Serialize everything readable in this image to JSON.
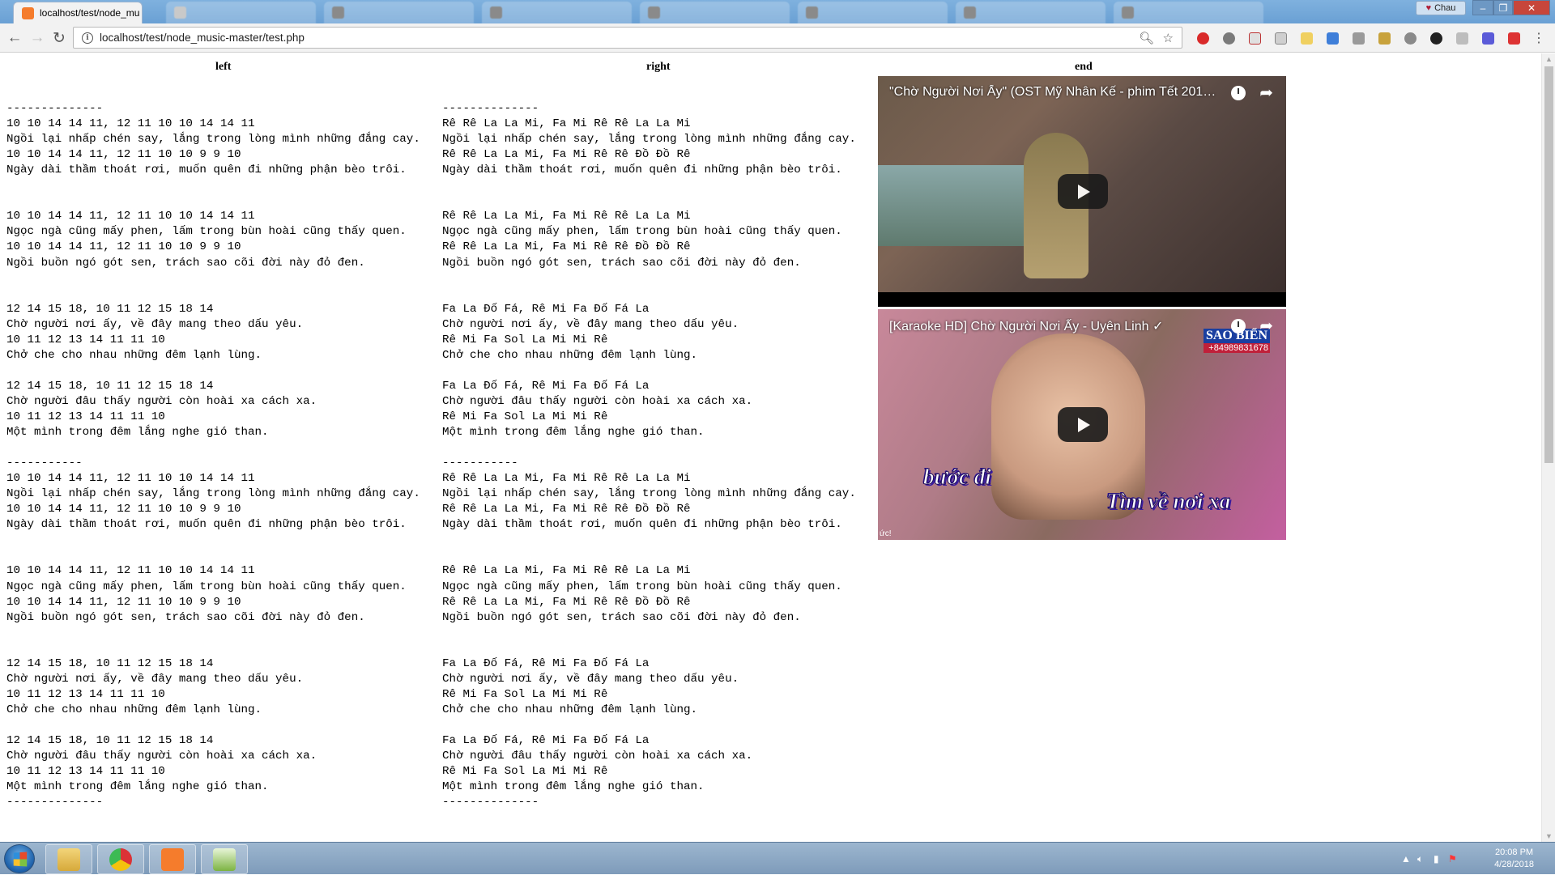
{
  "browser": {
    "tabs": [
      {
        "title": "localhost/test/node_mu",
        "active": true,
        "favicon_color": "#f57c2c"
      },
      {
        "title": "",
        "active": false,
        "favicon_color": "#c9c9c9"
      },
      {
        "title": "",
        "active": false,
        "favicon_color": "#8a8a8a"
      },
      {
        "title": "",
        "active": false,
        "favicon_color": "#8a8a8a"
      },
      {
        "title": "",
        "active": false,
        "favicon_color": "#8a8a8a"
      },
      {
        "title": "",
        "active": false,
        "favicon_color": "#8a8a8a"
      },
      {
        "title": "",
        "active": false,
        "favicon_color": "#8a8a8a"
      },
      {
        "title": "",
        "active": false,
        "favicon_color": "#8a8a8a"
      }
    ],
    "profile_name": "Chau",
    "url": "localhost/test/node_music-master/test.php"
  },
  "page": {
    "col_left": "left",
    "col_right": "right",
    "col_end": "end",
    "left_text": "\n--------------\n10 10 14 14 11, 12 11 10 10 14 14 11\nNgồi lại nhấp chén say, lắng trong lòng mình những đắng cay.\n10 10 14 14 11, 12 11 10 10 9 9 10\nNgày dài thầm thoát rơi, muốn quên đi những phận bèo trôi.\n\n\n10 10 14 14 11, 12 11 10 10 14 14 11\nNgọc ngà cũng mấy phen, lấm trong bùn hoài cũng thấy quen.\n10 10 14 14 11, 12 11 10 10 9 9 10\nNgồi buồn ngó gót sen, trách sao cõi đời này đỏ đen.\n\n\n12 14 15 18, 10 11 12 15 18 14\nChờ người nơi ấy, về đây mang theo dấu yêu.\n10 11 12 13 14 11 11 10\nChở che cho nhau những đêm lạnh lùng.\n\n12 14 15 18, 10 11 12 15 18 14\nChờ người đâu thấy người còn hoài xa cách xa.\n10 11 12 13 14 11 11 10\nMột mình trong đêm lắng nghe gió than.\n\n-----------\n10 10 14 14 11, 12 11 10 10 14 14 11\nNgồi lại nhấp chén say, lắng trong lòng mình những đắng cay.\n10 10 14 14 11, 12 11 10 10 9 9 10\nNgày dài thầm thoát rơi, muốn quên đi những phận bèo trôi.\n\n\n10 10 14 14 11, 12 11 10 10 14 14 11\nNgọc ngà cũng mấy phen, lấm trong bùn hoài cũng thấy quen.\n10 10 14 14 11, 12 11 10 10 9 9 10\nNgồi buồn ngó gót sen, trách sao cõi đời này đỏ đen.\n\n\n12 14 15 18, 10 11 12 15 18 14\nChờ người nơi ấy, về đây mang theo dấu yêu.\n10 11 12 13 14 11 11 10\nChở che cho nhau những đêm lạnh lùng.\n\n12 14 15 18, 10 11 12 15 18 14\nChờ người đâu thấy người còn hoài xa cách xa.\n10 11 12 13 14 11 11 10\nMột mình trong đêm lắng nghe gió than.\n--------------",
    "right_text": "\n--------------\nRê Rê La La Mi, Fa Mi Rê Rê La La Mi\nNgồi lại nhấp chén say, lắng trong lòng mình những đắng cay.\nRê Rê La La Mi, Fa Mi Rê Rê Đồ Đồ Rê\nNgày dài thầm thoát rơi, muốn quên đi những phận bèo trôi.\n\n\nRê Rê La La Mi, Fa Mi Rê Rê La La Mi\nNgọc ngà cũng mấy phen, lấm trong bùn hoài cũng thấy quen.\nRê Rê La La Mi, Fa Mi Rê Rê Đồ Đồ Rê\nNgồi buồn ngó gót sen, trách sao cõi đời này đỏ đen.\n\n\nFa La Đố Fá, Rê Mi Fa Đố Fá La\nChờ người nơi ấy, về đây mang theo dấu yêu.\nRê Mi Fa Sol La Mi Mi Rê\nChở che cho nhau những đêm lạnh lùng.\n\nFa La Đố Fá, Rê Mi Fa Đố Fá La\nChờ người đâu thấy người còn hoài xa cách xa.\nRê Mi Fa Sol La Mi Mi Rê\nMột mình trong đêm lắng nghe gió than.\n\n-----------\nRê Rê La La Mi, Fa Mi Rê Rê La La Mi\nNgồi lại nhấp chén say, lắng trong lòng mình những đắng cay.\nRê Rê La La Mi, Fa Mi Rê Rê Đồ Đồ Rê\nNgày dài thầm thoát rơi, muốn quên đi những phận bèo trôi.\n\n\nRê Rê La La Mi, Fa Mi Rê Rê La La Mi\nNgọc ngà cũng mấy phen, lấm trong bùn hoài cũng thấy quen.\nRê Rê La La Mi, Fa Mi Rê Rê Đồ Đồ Rê\nNgồi buồn ngó gót sen, trách sao cõi đời này đỏ đen.\n\n\nFa La Đố Fá, Rê Mi Fa Đố Fá La\nChờ người nơi ấy, về đây mang theo dấu yêu.\nRê Mi Fa Sol La Mi Mi Rê\nChở che cho nhau những đêm lạnh lùng.\n\nFa La Đố Fá, Rê Mi Fa Đố Fá La\nChờ người đâu thấy người còn hoài xa cách xa.\nRê Mi Fa Sol La Mi Mi Rê\nMột mình trong đêm lắng nghe gió than.\n--------------",
    "videos": [
      {
        "title": "\"Chờ Người Nơi Ấy\" (OST Mỹ Nhân Kế - phim Tết 2013) -..."
      },
      {
        "title": "[Karaoke HD] Chờ Người Nơi Ấy - Uyên Linh ✓",
        "channel_logo": "SAO BIỂN",
        "channel_phone": "+84989831678",
        "caption_1": "bước đi",
        "caption_2": "Tìm về nơi xa",
        "corner_text": "ức!"
      }
    ]
  },
  "taskbar": {
    "time": "20:08 PM",
    "date": "4/28/2018"
  },
  "colors": {
    "titlebar": "#6aa0d4",
    "toolbar": "#f2f2f2",
    "taskbar": "#8aa7c4"
  }
}
